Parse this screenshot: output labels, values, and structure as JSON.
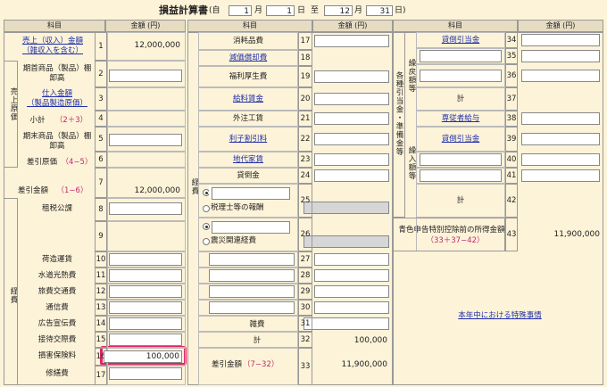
{
  "title": {
    "main": "損益計算書",
    "open_paren": "(自",
    "start_month": "1",
    "month_label": "月",
    "start_day": "1",
    "day_label": "日",
    "to_label": "至",
    "end_month": "12",
    "end_month_label": "月",
    "end_day": "31",
    "end_day_label": "日)"
  },
  "headers": {
    "item": "科目",
    "amount": "金額 (円)"
  },
  "col1": {
    "sales_link": "売上（収入）金額\n（雑収入を含む）",
    "sales_value": "12,000,000",
    "cost_group": "売上原価",
    "opening_stock": "期首商品（製品）棚卸高",
    "purchases_link": "仕入金額\n（製品製造原価）",
    "subtotal": "小計",
    "subtotal_formula": "（2＋3）",
    "closing_stock": "期末商品（製品）棚卸高",
    "cogs": "差引原価",
    "cogs_formula": "（4−5）",
    "gross_profit": "差引金額",
    "gross_formula": "（1−6）",
    "gross_value": "12,000,000",
    "expenses_group": "経費",
    "taxes": "租税公課",
    "shipping": "荷造運賃",
    "utilities": "水道光熱費",
    "travel": "旅費交通費",
    "communication": "通信費",
    "advertising": "広告宣伝費",
    "entertainment": "接待交際費",
    "insurance": "損害保険料",
    "insurance_value": "100,000",
    "repairs": "修繕費"
  },
  "col2": {
    "expenses_group": "経費",
    "supplies": "消耗品費",
    "depreciation_link": "減価償却費",
    "welfare": "福利厚生費",
    "salaries_link": "給料賃金",
    "outsourcing": "外注工賃",
    "interest_link": "利子割引料",
    "rent_link": "地代家賃",
    "bad_debt": "貸倒金",
    "tax_accountant": "税理士等の報酬",
    "disaster": "震災関連経費",
    "misc": "雑費",
    "total": "計",
    "total_value": "100,000",
    "net": "差引金額",
    "net_formula": "（7−32）",
    "net_value": "11,900,000"
  },
  "col3": {
    "group_main": "各種引当金・準備金等",
    "group_carry": "繰戻額等",
    "group_into": "繰入額等",
    "reserve_link": "貸倒引当金",
    "total": "計",
    "employee_link": "専従者給与",
    "reserve_link2": "貸倒引当金",
    "pre_deduction": "青色申告特別控除前の所得金額",
    "pre_formula": "（33＋37−42）",
    "pre_value": "11,900,000",
    "special_link": "本年中における特殊事情"
  },
  "line_numbers": [
    "1",
    "2",
    "3",
    "4",
    "5",
    "6",
    "7",
    "8",
    "9",
    "10",
    "11",
    "12",
    "13",
    "14",
    "15",
    "16",
    "17",
    "18",
    "19",
    "20",
    "21",
    "22",
    "23",
    "24",
    "25",
    "26",
    "27",
    "28",
    "29",
    "30",
    "31",
    "32",
    "33",
    "34",
    "35",
    "36",
    "37",
    "38",
    "39",
    "40",
    "41",
    "42",
    "43"
  ]
}
